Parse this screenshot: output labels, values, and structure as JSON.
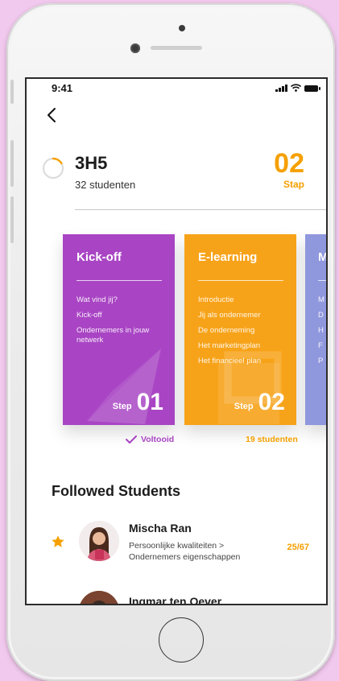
{
  "status_bar": {
    "time": "9:41"
  },
  "header": {
    "group_code": "3H5",
    "group_subtitle": "32 studenten",
    "step_number": "02",
    "step_label": "Stap"
  },
  "cards": [
    {
      "title": "Kick-off",
      "items": [
        "Wat vind jij?",
        "Kick-off",
        "Ondernemers in jouw netwerk"
      ],
      "step_word": "Step",
      "step_number": "01",
      "status": "Voltooid",
      "color": "#a945c4"
    },
    {
      "title": "E-learning",
      "items": [
        "Introductie",
        "Jij als ondernemer",
        "De onderneming",
        "Het marketingplan",
        "Het financieel plan"
      ],
      "step_word": "Step",
      "step_number": "02",
      "status": "19 studenten",
      "color": "#f7a31a"
    },
    {
      "title": "M",
      "items": [
        "M",
        "D",
        "H",
        "F",
        "P"
      ],
      "color": "#8f97dd"
    }
  ],
  "followed": {
    "title": "Followed Students",
    "students": [
      {
        "name": "Mischa Ran",
        "progress": "Persoonlijke kwaliteiten > Ondernemers eigenschappen",
        "score": "25/67"
      },
      {
        "name": "Ingmar ten Oever"
      }
    ]
  },
  "colors": {
    "accent": "#f5a000",
    "purple": "#a945c4",
    "orange": "#f7a31a",
    "lavender": "#8f97dd",
    "background": "#f2c9ee"
  }
}
